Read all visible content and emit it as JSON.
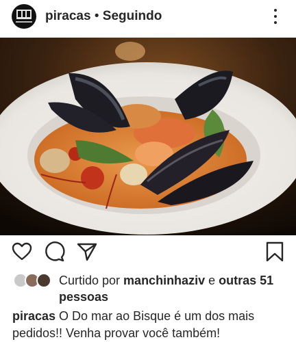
{
  "post": {
    "username": "piracas",
    "separator": " • ",
    "follow_status": "Seguindo",
    "more_icon": "more-vertical-icon"
  },
  "actions": {
    "like_icon": "heart-icon",
    "comment_icon": "comment-icon",
    "share_icon": "send-icon",
    "save_icon": "bookmark-icon"
  },
  "likes": {
    "prefix": "Curtido por ",
    "user": "manchinhaziv",
    "middle": " e ",
    "others": "outras 51 pessoas"
  },
  "caption": {
    "username": "piracas",
    "text": " O Do mar ao Bisque é um dos mais pedidos!! Venha provar você também!"
  }
}
